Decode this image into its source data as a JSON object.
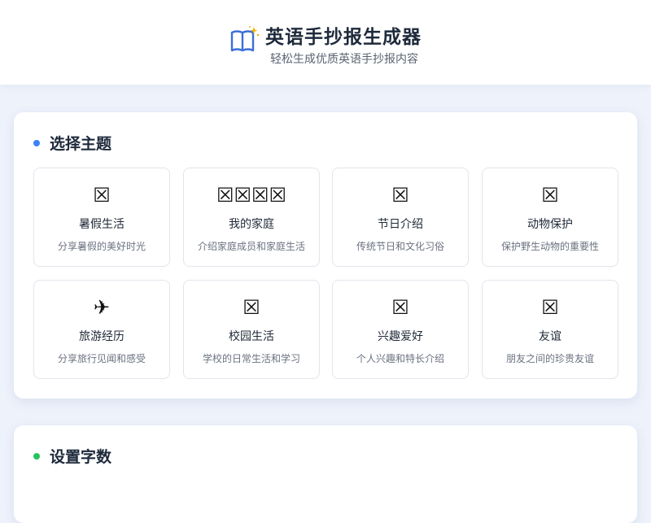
{
  "header": {
    "title": "英语手抄报生成器",
    "subtitle": "轻松生成优质英语手抄报内容",
    "logo_icon": "open-book-sparkle-icon"
  },
  "theme_section": {
    "title": "选择主题",
    "dot_color": "#3b82f6",
    "tiles": [
      {
        "icon": "☒",
        "name": "暑假生活",
        "desc": "分享暑假的美好时光"
      },
      {
        "icon": "☒☒☒☒",
        "name": "我的家庭",
        "desc": "介绍家庭成员和家庭生活"
      },
      {
        "icon": "☒",
        "name": "节日介绍",
        "desc": "传统节日和文化习俗"
      },
      {
        "icon": "☒",
        "name": "动物保护",
        "desc": "保护野生动物的重要性"
      },
      {
        "icon": "✈",
        "name": "旅游经历",
        "desc": "分享旅行见闻和感受"
      },
      {
        "icon": "☒",
        "name": "校园生活",
        "desc": "学校的日常生活和学习"
      },
      {
        "icon": "☒",
        "name": "兴趣爱好",
        "desc": "个人兴趣和特长介绍"
      },
      {
        "icon": "☒",
        "name": "友谊",
        "desc": "朋友之间的珍贵友谊"
      }
    ]
  },
  "words_section": {
    "title": "设置字数",
    "dot_color": "#22c55e"
  },
  "colors": {
    "accent": "#2f6fdf",
    "background": "#eef2fb"
  }
}
